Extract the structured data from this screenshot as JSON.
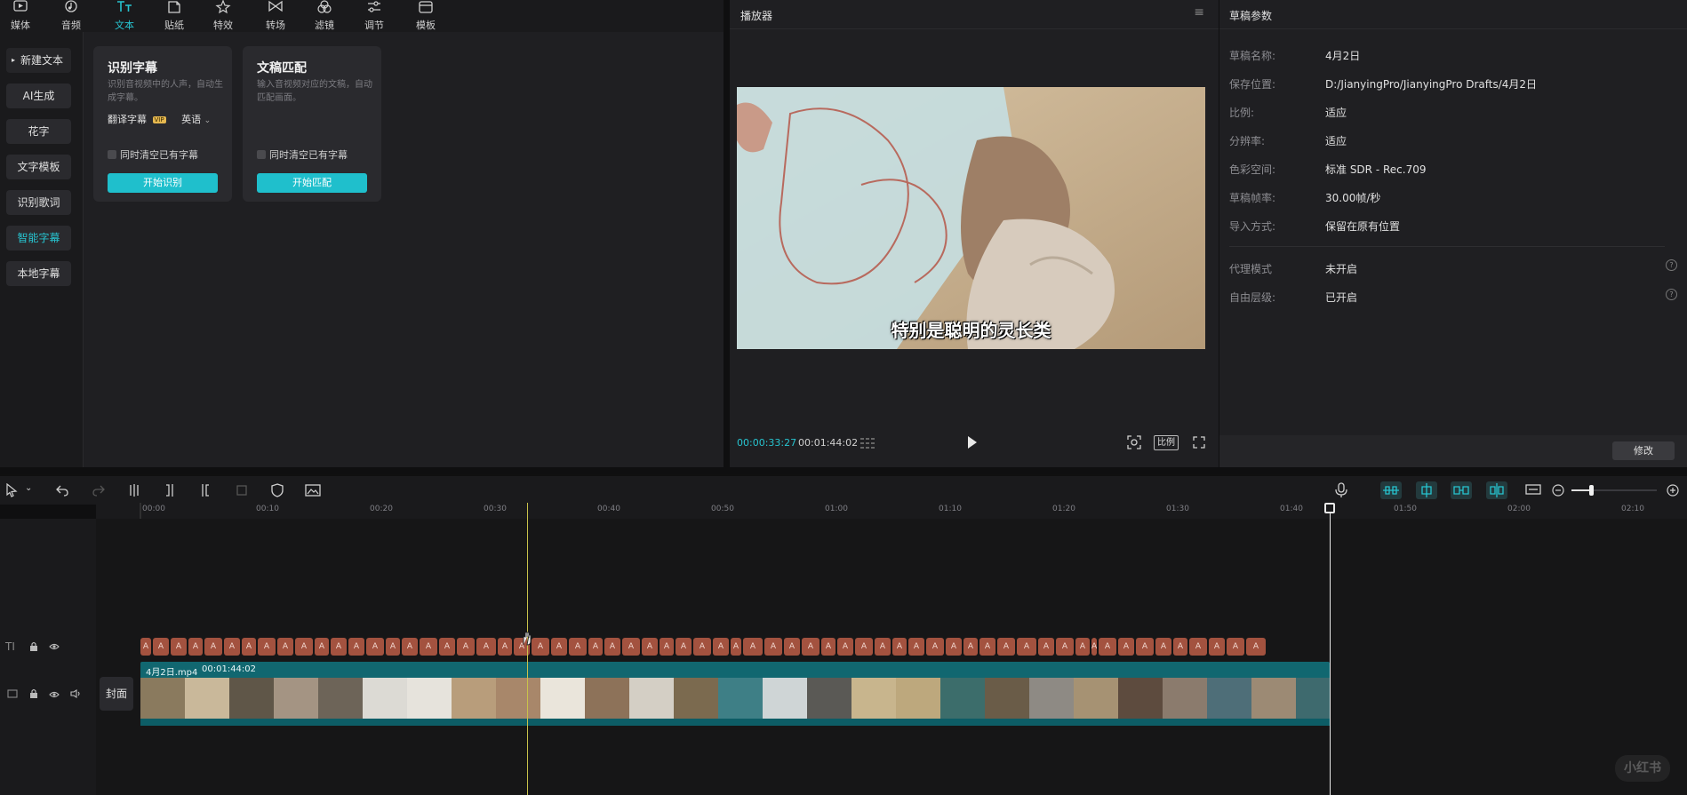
{
  "top_tabs": [
    {
      "label": "媒体",
      "icon": "media-icon"
    },
    {
      "label": "音频",
      "icon": "audio-icon"
    },
    {
      "label": "文本",
      "icon": "text-icon"
    },
    {
      "label": "贴纸",
      "icon": "sticker-icon"
    },
    {
      "label": "特效",
      "icon": "effects-icon"
    },
    {
      "label": "转场",
      "icon": "transition-icon"
    },
    {
      "label": "滤镜",
      "icon": "filter-icon"
    },
    {
      "label": "调节",
      "icon": "adjust-icon"
    },
    {
      "label": "模板",
      "icon": "template-icon"
    }
  ],
  "left_nav": [
    "新建文本",
    "AI生成",
    "花字",
    "文字模板",
    "识别歌词",
    "智能字幕",
    "本地字幕"
  ],
  "card_recognize": {
    "title": "识别字幕",
    "desc": "识别音视频中的人声，自动生成字幕。",
    "translate_label": "翻译字幕",
    "vip": "VIP",
    "lang": "英语",
    "clear_label": "同时清空已有字幕",
    "button": "开始识别"
  },
  "card_match": {
    "title": "文稿匹配",
    "desc": "输入音视频对应的文稿，自动匹配画面。",
    "clear_label": "同时清空已有字幕",
    "button": "开始匹配"
  },
  "player": {
    "title": "播放器",
    "subtitle": "特别是聪明的灵长类",
    "current_time": "00:00:33:27",
    "total_time": "00:01:44:02",
    "ratio_label": "比例"
  },
  "params": {
    "title": "草稿参数",
    "rows": [
      {
        "k": "草稿名称:",
        "v": "4月2日"
      },
      {
        "k": "保存位置:",
        "v": "D:/JianyingPro/JianyingPro Drafts/4月2日"
      },
      {
        "k": "比例:",
        "v": "适应"
      },
      {
        "k": "分辨率:",
        "v": "适应"
      },
      {
        "k": "色彩空间:",
        "v": "标准 SDR - Rec.709"
      },
      {
        "k": "草稿帧率:",
        "v": "30.00帧/秒"
      },
      {
        "k": "导入方式:",
        "v": "保留在原有位置"
      },
      {
        "k": "代理模式",
        "v": "未开启"
      },
      {
        "k": "自由层级:",
        "v": "已开启"
      }
    ],
    "modify_button": "修改"
  },
  "timeline": {
    "ticks": [
      "00:00",
      "00:10",
      "00:20",
      "00:30",
      "00:40",
      "00:50",
      "01:00",
      "01:10",
      "01:20",
      "01:30",
      "01:40",
      "01:50",
      "02:00",
      "02:10"
    ],
    "clip_name": "4月2日.mp4",
    "clip_duration": "00:01:44:02",
    "cover_label": "封面",
    "caption_label": "A"
  },
  "watermark": "小红书",
  "colors": {
    "accent": "#27c4d0",
    "caption": "#a3523f",
    "video_track": "#116770"
  }
}
